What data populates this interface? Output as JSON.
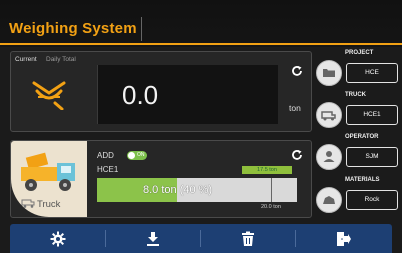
{
  "app": {
    "title": "Weighing System"
  },
  "weight": {
    "tabs": [
      "Current",
      "Daily Total"
    ],
    "value": "0.0",
    "unit": "ton"
  },
  "load": {
    "truck_label": "Truck",
    "add_label": "ADD",
    "toggle_text": "ON",
    "truck_id": "HCE1",
    "target_chip": "17.5 ton",
    "progress_text": "8.0 ton (40 %)",
    "progress_fraction": 0.4,
    "capacity": "20.0 ton"
  },
  "info": [
    {
      "title": "PROJECT",
      "value": "HCE",
      "icon": "folder-icon"
    },
    {
      "title": "TRUCK",
      "value": "HCE1",
      "icon": "truck-icon"
    },
    {
      "title": "OPERATOR",
      "value": "SJM",
      "icon": "person-icon"
    },
    {
      "title": "MATERIALS",
      "value": "Rock",
      "icon": "rock-icon"
    }
  ],
  "toolbar": [
    {
      "name": "settings",
      "icon": "gear-icon"
    },
    {
      "name": "download",
      "icon": "download-icon"
    },
    {
      "name": "delete",
      "icon": "trash-icon"
    },
    {
      "name": "exit",
      "icon": "exit-icon"
    }
  ],
  "colors": {
    "accent": "#f2a114",
    "toolbar": "#1d3f73",
    "progress": "#8cc34a"
  }
}
